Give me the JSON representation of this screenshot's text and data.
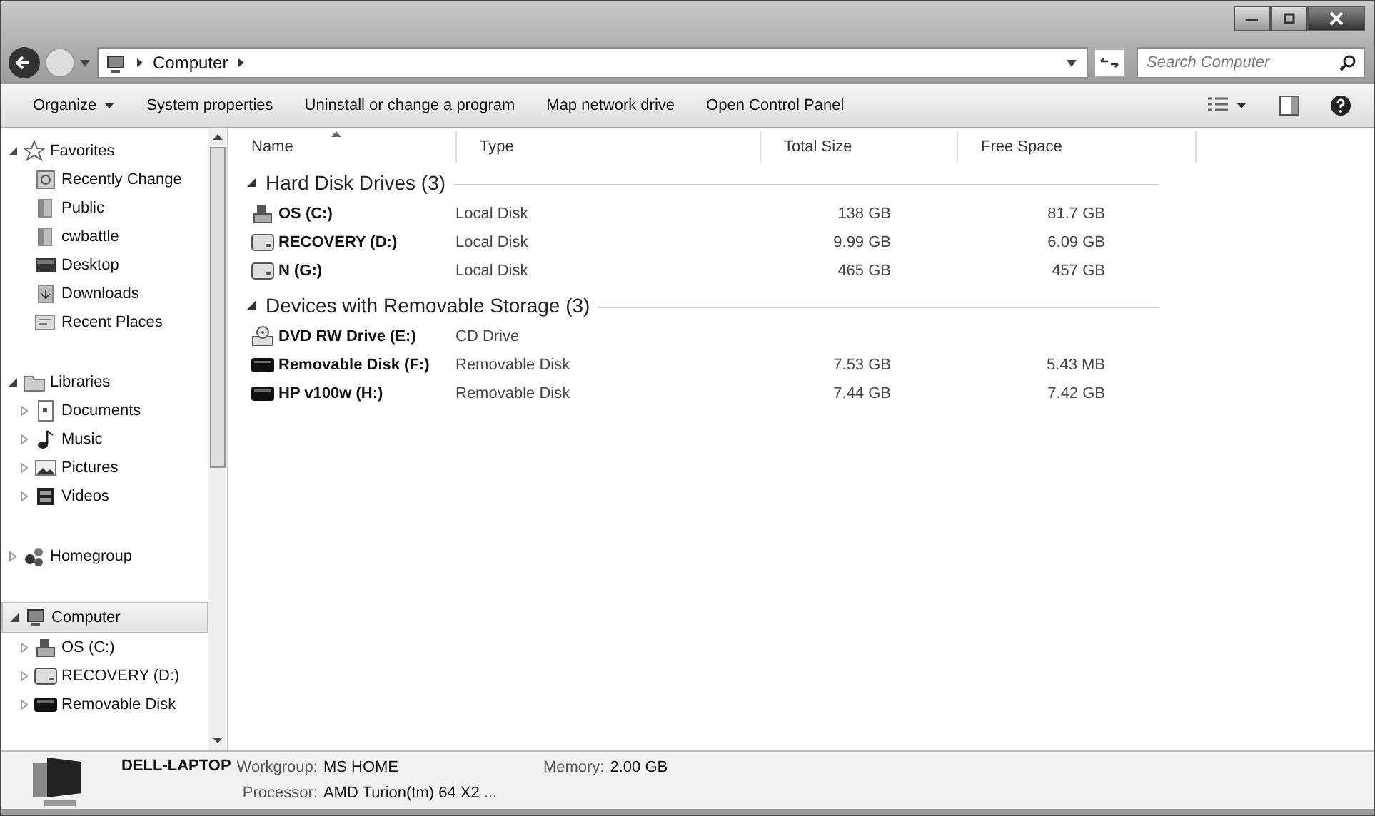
{
  "address_bar": {
    "crumbs": [
      "Computer"
    ]
  },
  "search": {
    "placeholder": "Search Computer"
  },
  "toolbar": {
    "buttons": [
      {
        "label": "Organize",
        "dropdown": true
      },
      {
        "label": "System properties",
        "dropdown": false
      },
      {
        "label": "Uninstall or change a program",
        "dropdown": false
      },
      {
        "label": "Map network drive",
        "dropdown": false
      },
      {
        "label": "Open Control Panel",
        "dropdown": false
      }
    ]
  },
  "sidebar": {
    "items": [
      {
        "label": "Favorites",
        "kind": "star",
        "expanded": true,
        "selected": false,
        "children": [
          {
            "label": "Recently Change",
            "kind": "recent-changed",
            "selected": false
          },
          {
            "label": "Public",
            "kind": "folder",
            "selected": false
          },
          {
            "label": "cwbattle",
            "kind": "folder",
            "selected": false
          },
          {
            "label": "Desktop",
            "kind": "desktop",
            "selected": false
          },
          {
            "label": "Downloads",
            "kind": "downloads",
            "selected": false
          },
          {
            "label": "Recent Places",
            "kind": "recent",
            "selected": false
          }
        ]
      },
      {
        "label": "Libraries",
        "kind": "library",
        "expanded": true,
        "selected": false,
        "children": [
          {
            "label": "Documents",
            "kind": "document",
            "expanded": false,
            "selected": false
          },
          {
            "label": "Music",
            "kind": "music",
            "expanded": false,
            "selected": false
          },
          {
            "label": "Pictures",
            "kind": "pictures",
            "expanded": false,
            "selected": false
          },
          {
            "label": "Videos",
            "kind": "videos",
            "expanded": false,
            "selected": false
          }
        ]
      },
      {
        "label": "Homegroup",
        "kind": "homegroup",
        "expanded": false,
        "selected": false
      },
      {
        "label": "Computer",
        "kind": "computer",
        "expanded": true,
        "selected": true,
        "children": [
          {
            "label": "OS (C:)",
            "kind": "system-drive",
            "expanded": false,
            "selected": false
          },
          {
            "label": "RECOVERY (D:)",
            "kind": "drive",
            "expanded": false,
            "selected": false
          },
          {
            "label": "Removable Disk",
            "kind": "removable",
            "expanded": false,
            "selected": false
          }
        ]
      }
    ]
  },
  "table": {
    "columns": [
      "Name",
      "Type",
      "Total Size",
      "Free Space"
    ],
    "groups": [
      {
        "title": "Hard Disk Drives (3)",
        "expanded": true,
        "rows": [
          {
            "kind": "system-drive",
            "name": "OS (C:)",
            "type": "Local Disk",
            "total_size": "138 GB",
            "free_space": "81.7 GB"
          },
          {
            "kind": "drive",
            "name": "RECOVERY (D:)",
            "type": "Local Disk",
            "total_size": "9.99 GB",
            "free_space": "6.09 GB"
          },
          {
            "kind": "drive",
            "name": "N (G:)",
            "type": "Local Disk",
            "total_size": "465 GB",
            "free_space": "457 GB"
          }
        ]
      },
      {
        "title": "Devices with Removable Storage (3)",
        "expanded": true,
        "rows": [
          {
            "kind": "dvd",
            "name": "DVD RW Drive (E:)",
            "type": "CD Drive"
          },
          {
            "kind": "removable",
            "name": "Removable Disk (F:)",
            "type": "Removable Disk",
            "total_size": "7.53 GB",
            "free_space": "5.43 MB"
          },
          {
            "kind": "removable",
            "name": "HP v100w (H:)",
            "type": "Removable Disk",
            "total_size": "7.44 GB",
            "free_space": "7.42 GB"
          }
        ]
      }
    ]
  },
  "details_pane": {
    "name": "DELL-LAPTOP",
    "fields": [
      {
        "label": "Workgroup:",
        "value": "MS HOME"
      },
      {
        "label": "Memory:",
        "value": "2.00 GB"
      },
      {
        "label": "Processor:",
        "value": "AMD Turion(tm) 64 X2 ..."
      }
    ]
  }
}
